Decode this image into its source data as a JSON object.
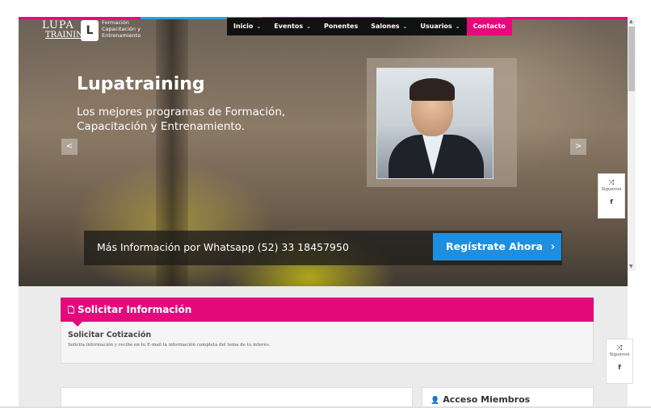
{
  "header": {
    "logo": {
      "lupa": "LUPA",
      "training": "TRAINING",
      "tagline_1": "Formación",
      "tagline_2": "Capacitación y",
      "tagline_3": "Entrenamiento"
    },
    "nav": [
      {
        "label": "Inicio",
        "has_dropdown": true
      },
      {
        "label": "Eventos",
        "has_dropdown": true
      },
      {
        "label": "Ponentes",
        "has_dropdown": false
      },
      {
        "label": "Salones",
        "has_dropdown": true
      },
      {
        "label": "Usuarios",
        "has_dropdown": true
      },
      {
        "label": "Contacto",
        "has_dropdown": false
      }
    ]
  },
  "slider": {
    "title": "Lupatraining",
    "subtitle": "Los mejores programas de Formación, Capacitación y Entrenamiento.",
    "prev_icon": "chevron-left-icon",
    "next_icon": "chevron-right-icon"
  },
  "cta": {
    "text": "Más Información por Whatsapp (52) 33 18457950",
    "button_label": "Regístrate Ahora"
  },
  "social_widget": {
    "share_icon": "shuffle-icon",
    "label": "Síguenos",
    "facebook": "f"
  },
  "info_panel": {
    "heading": "Solicitar Información",
    "subtitle": "Solicitar Cotización",
    "description": "Solicita información y recibe en tu E-mail la información completa del tema de tu interés."
  },
  "members": {
    "title": "Acceso Miembros"
  },
  "colors": {
    "accent": "#e40a7c",
    "button_blue": "#1e8fe0",
    "nav_bg": "#111111"
  }
}
